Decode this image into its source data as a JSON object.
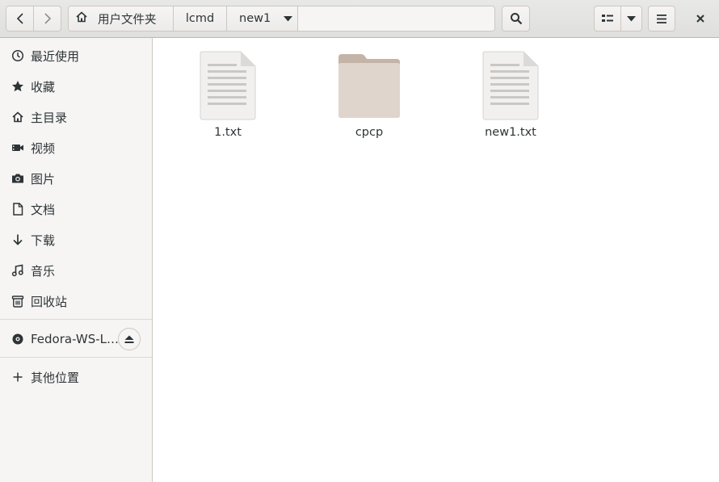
{
  "header": {
    "breadcrumbs": [
      "用户文件夹",
      "lcmd",
      "new1"
    ]
  },
  "sidebar": {
    "items": [
      {
        "label": "最近使用",
        "icon": "clock-icon"
      },
      {
        "label": "收藏",
        "icon": "star-icon"
      },
      {
        "label": "主目录",
        "icon": "home-icon"
      },
      {
        "label": "视频",
        "icon": "video-icon"
      },
      {
        "label": "图片",
        "icon": "camera-icon"
      },
      {
        "label": "文档",
        "icon": "document-icon"
      },
      {
        "label": "下载",
        "icon": "download-icon"
      },
      {
        "label": "音乐",
        "icon": "music-icon"
      },
      {
        "label": "回收站",
        "icon": "trash-icon"
      }
    ],
    "device": {
      "label": "Fedora-WS-L…",
      "icon": "disc-icon"
    },
    "other": {
      "label": "其他位置",
      "icon": "plus-icon"
    }
  },
  "files": [
    {
      "name": "1.txt",
      "type": "text"
    },
    {
      "name": "cpcp",
      "type": "folder"
    },
    {
      "name": "new1.txt",
      "type": "text"
    }
  ],
  "colors": {
    "folder_body": "#dfd5cc",
    "folder_tab": "#c4b4a7",
    "sidebar_bg": "#f6f5f4",
    "header_bg": "#e8e8e7"
  }
}
